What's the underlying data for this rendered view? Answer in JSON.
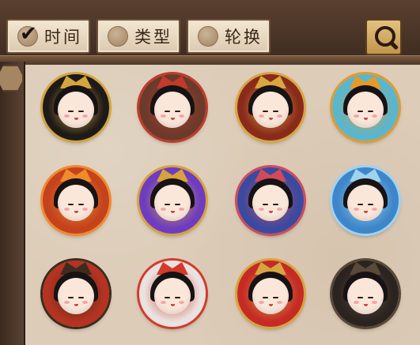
{
  "filters": [
    {
      "label": "时间",
      "selected": true
    },
    {
      "label": "类型",
      "selected": false
    },
    {
      "label": "轮换",
      "selected": false
    }
  ],
  "search": {
    "icon": "magnifier-icon"
  },
  "colors": {
    "panel_bg": "#dcccb8",
    "frame_wood": "#3d2b20",
    "button_bg": "#ecdcc3",
    "accent_gold": "#d5a84a"
  },
  "avatar_frames": [
    {
      "theme": "gold-samurai-helmet",
      "ring": "#1e1a18",
      "accent": "#d4a53d"
    },
    {
      "theme": "red-oni-horns",
      "ring": "#6b3a2a",
      "accent": "#c23a2a"
    },
    {
      "theme": "gold-red-kabuto",
      "ring": "#8a2a1a",
      "accent": "#d9a640"
    },
    {
      "theme": "autumn-maple-leaves",
      "ring": "#59b6cf",
      "accent": "#e49a2a"
    },
    {
      "theme": "flame-blossom",
      "ring": "#c4421c",
      "accent": "#f18a2b"
    },
    {
      "theme": "gold-dragon",
      "ring": "#6d3cc0",
      "accent": "#d8a33a"
    },
    {
      "theme": "fox-mask-drum",
      "ring": "#3a4aa0",
      "accent": "#d24a5a"
    },
    {
      "theme": "blue-water-swirl",
      "ring": "#3d86c9",
      "accent": "#9fd3f0"
    },
    {
      "theme": "lantern-wheel",
      "ring": "#b53320",
      "accent": "#3d2b1f"
    },
    {
      "theme": "white-fur-demon",
      "ring": "#e9e2e0",
      "accent": "#d33a2a"
    },
    {
      "theme": "red-gold-vine",
      "ring": "#c52a25",
      "accent": "#d6a53f"
    },
    {
      "theme": "plain-black",
      "ring": "#2b2320",
      "accent": "#5a4838"
    }
  ]
}
